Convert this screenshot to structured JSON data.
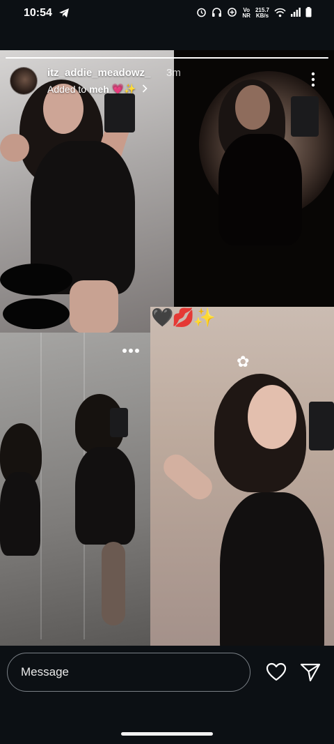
{
  "status_bar": {
    "time": "10:54",
    "network_label_top": "Vo",
    "network_label_bottom": "NR",
    "speed_value": "215.7",
    "speed_unit": "KB/s"
  },
  "story": {
    "progress": 1.0,
    "username": "itz_addie_meadowz_",
    "time_ago": "3m",
    "added_prefix": "Added to",
    "highlight_name": "meh",
    "highlight_emoji": "💗✨",
    "sticker_emojis": "🖤💋✨"
  },
  "reply_bar": {
    "message_placeholder": "Message"
  },
  "icons": {
    "telegram": "telegram-icon",
    "alarm": "alarm-icon",
    "headphones": "headphones-icon",
    "data_saver": "data-saver-icon",
    "wifi": "wifi-icon",
    "signal": "signal-icon",
    "battery": "battery-icon",
    "more": "more-vertical-icon",
    "chevron": "chevron-right-icon",
    "heart": "heart-icon",
    "send": "send-icon"
  }
}
